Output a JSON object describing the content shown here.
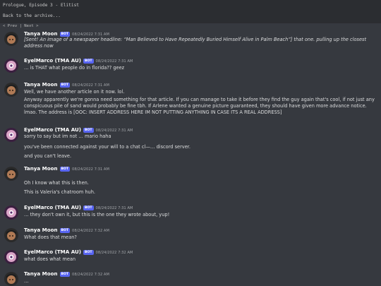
{
  "page": {
    "title": "Prologue, Episode 3 - Elitist",
    "back_link": "Back to the archive...",
    "nav": "< Prev | Next >"
  },
  "bot_label": "BOT",
  "messages": [
    {
      "author": "Tanya Moon",
      "time": "08/24/2022 7:31 AM",
      "lines": [
        "[Sent! An image of a newspaper headline: “Man Believed to Have Repeatedly Buried Himself Alive in Palm Beach”] that one. pulling up the closest address now"
      ]
    },
    {
      "author": "EyelMarco (TMA AU)",
      "time": "08/24/2022 7:31 AM",
      "lines": [
        "… is THAT what people do in florida?? geez"
      ]
    },
    {
      "author": "Tanya Moon",
      "time": "08/24/2022 7:31 AM",
      "lines": [
        "Well, we have another article on it now. lol.",
        "Anyway apparently we're gonna need something for that article. If you can manage to take it before they find the guy again that's cool, if not just any conspicuous pile of sand would probably be fine tbh. If Arlene wanted a genuine picture guaranteed, they should have given more advance notice. lmao. The address is [OOC: INSERT ADDRESS HERE IM NOT PUTTING ANYTHING IN CASE ITS A REAL ADDRESS]"
      ]
    },
    {
      "author": "EyelMarco (TMA AU)",
      "time": "08/24/2022 7:31 AM",
      "lines": [
        "sorry to say but im not … mario haha",
        "you've been connected against your will to a chat cl—… discord server.",
        "and you can't leave."
      ]
    },
    {
      "author": "Tanya Moon",
      "time": "08/24/2022 7:31 AM",
      "lines": [
        "Oh I know what this is then.",
        "This is Valeria's chatroom huh."
      ]
    },
    {
      "author": "EyelMarco (TMA AU)",
      "time": "08/24/2022 7:31 AM",
      "lines": [
        "… they don't own it, but this is the one they wrote about, yup!"
      ]
    },
    {
      "author": "Tanya Moon",
      "time": "08/24/2022 7:32 AM",
      "lines": [
        "What does that mean?"
      ]
    },
    {
      "author": "EyelMarco (TMA AU)",
      "time": "08/24/2022 7:32 AM",
      "lines": [
        "what does what mean"
      ]
    },
    {
      "author": "Tanya Moon",
      "time": "08/24/2022 7:32 AM",
      "lines": [
        "…"
      ]
    }
  ]
}
